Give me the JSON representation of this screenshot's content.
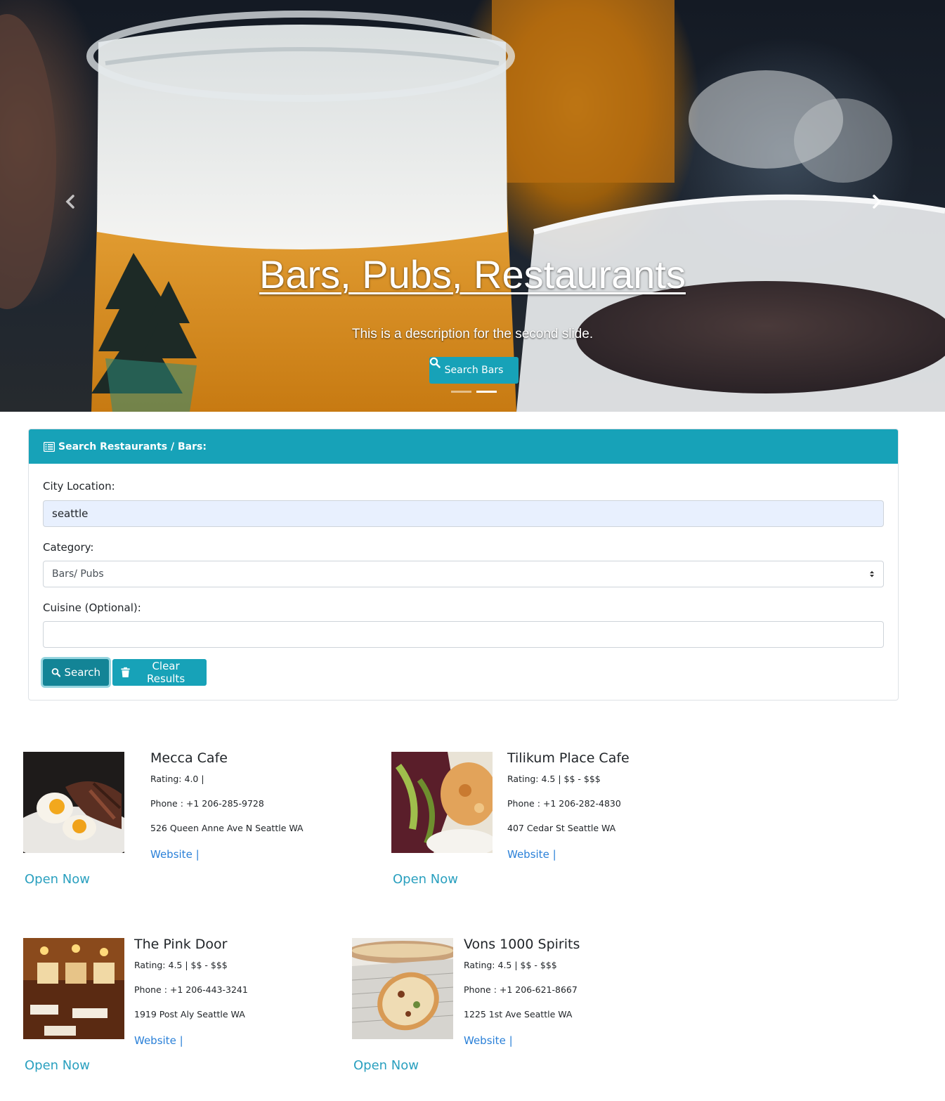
{
  "hero": {
    "title": "Bars, Pubs, Restaurants",
    "description": "This is a description for the second slide.",
    "button_label": "Search Bars",
    "active_slide": 2,
    "slide_count": 2
  },
  "search_card": {
    "header": "Search Restaurants / Bars:",
    "city_label": "City Location:",
    "city_value": "seattle",
    "category_label": "Category:",
    "category_value": "Bars/ Pubs",
    "cuisine_label": "Cuisine (Optional):",
    "cuisine_value": "",
    "search_button": "Search",
    "clear_button": "Clear Results"
  },
  "results": [
    {
      "name": "Mecca Cafe",
      "rating": "Rating: 4.0 |",
      "phone": "Phone : +1 206-285-9728",
      "address": "526 Queen Anne Ave N Seattle WA",
      "website": "Website |",
      "status": "Open Now"
    },
    {
      "name": "Tilikum Place Cafe",
      "rating": "Rating: 4.5 | $$ - $$$",
      "phone": "Phone : +1 206-282-4830",
      "address": "407 Cedar St Seattle WA",
      "website": "Website |",
      "status": "Open Now"
    },
    {
      "name": "The Pink Door",
      "rating": "Rating: 4.5 | $$ - $$$",
      "phone": "Phone : +1 206-443-3241",
      "address": "1919 Post Aly Seattle WA",
      "website": "Website |",
      "status": "Open Now"
    },
    {
      "name": "Vons 1000 Spirits",
      "rating": "Rating: 4.5 | $$ - $$$",
      "phone": "Phone : +1 206-621-8667",
      "address": "1225 1st Ave Seattle WA",
      "website": "Website |",
      "status": "Open Now"
    }
  ],
  "colors": {
    "accent": "#17a2b8",
    "link": "#2a80d8",
    "open_status": "#2aa0bf"
  }
}
